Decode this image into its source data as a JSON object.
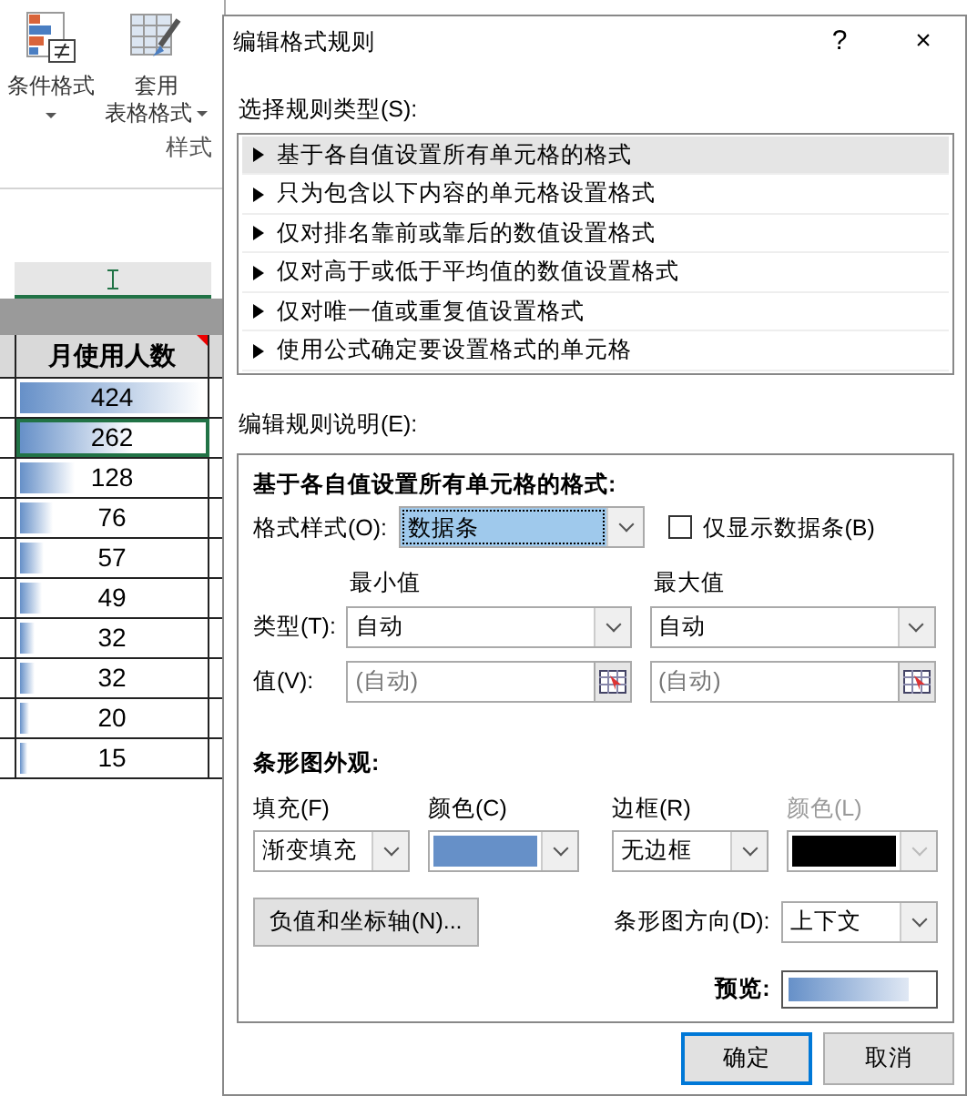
{
  "ribbon": {
    "buttons": [
      {
        "label": "条件格式",
        "kind": "conditional"
      },
      {
        "label": "套用",
        "label2": "表格格式",
        "kind": "table"
      }
    ],
    "group_label": "样式"
  },
  "sheet": {
    "header": "月使用人数",
    "rows": [
      {
        "value": "424",
        "level": 1.0,
        "selected": false
      },
      {
        "value": "262",
        "level": 0.618,
        "selected": true
      },
      {
        "value": "128",
        "level": 0.302,
        "selected": false
      },
      {
        "value": "76",
        "level": 0.179,
        "selected": false
      },
      {
        "value": "57",
        "level": 0.134,
        "selected": false
      },
      {
        "value": "49",
        "level": 0.116,
        "selected": false
      },
      {
        "value": "32",
        "level": 0.075,
        "selected": false
      },
      {
        "value": "32",
        "level": 0.075,
        "selected": false
      },
      {
        "value": "20",
        "level": 0.047,
        "selected": false
      },
      {
        "value": "15",
        "level": 0.035,
        "selected": false
      }
    ]
  },
  "dialog": {
    "title": "编辑格式规则",
    "help": "?",
    "close": "×",
    "rule_type_label": "选择规则类型(S):",
    "rule_types": [
      {
        "label": "基于各自值设置所有单元格的格式",
        "selected": true
      },
      {
        "label": "只为包含以下内容的单元格设置格式",
        "selected": false
      },
      {
        "label": "仅对排名靠前或靠后的数值设置格式",
        "selected": false
      },
      {
        "label": "仅对高于或低于平均值的数值设置格式",
        "selected": false
      },
      {
        "label": "仅对唯一值或重复值设置格式",
        "selected": false
      },
      {
        "label": "使用公式确定要设置格式的单元格",
        "selected": false
      }
    ],
    "description_label": "编辑规则说明(E):",
    "description_heading": "基于各自值设置所有单元格的格式:",
    "format_style_label": "格式样式(O):",
    "format_style": "数据条",
    "show_bar_only": {
      "label": "仅显示数据条(B)",
      "checked": false
    },
    "min_heading": "最小值",
    "max_heading": "最大值",
    "type_label": "类型(T):",
    "value_label": "值(V):",
    "min_type": "自动",
    "max_type": "自动",
    "min_value_placeholder": "(自动)",
    "max_value_placeholder": "(自动)",
    "appearance_heading": "条形图外观:",
    "fill_label": "填充(F)",
    "fill": "渐变填充",
    "fill_color": {
      "label": "颜色(C)",
      "color": "#6690c8"
    },
    "border_label": "边框(R)",
    "border": "无边框",
    "border_color": {
      "label": "颜色(L)",
      "color": "#000000",
      "disabled": true
    },
    "axis_button": "负值和坐标轴(N)...",
    "direction_label": "条形图方向(D):",
    "direction": "上下文",
    "preview": {
      "label": "预览:",
      "level": 0.85
    },
    "ok": "确定",
    "cancel": "取消"
  }
}
